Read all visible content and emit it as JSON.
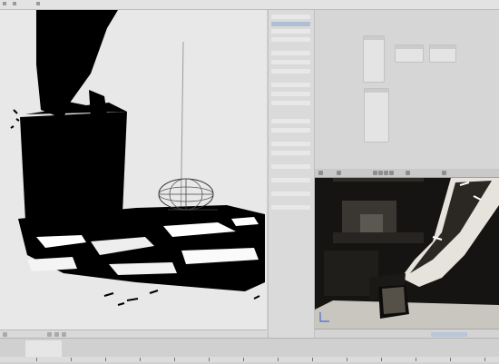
{
  "app": {
    "colors": {
      "ui_bg": "#d2d2d2",
      "viewport_bg": "#e8e8e8",
      "render_bg": "#161412",
      "accent": "#aebfd4"
    }
  },
  "icons": {
    "menu": "menu-icon",
    "axis": "axis-gizmo-icon",
    "render_tools": "render-tool-icon",
    "timeline_tick": "timeline-tick-icon"
  }
}
